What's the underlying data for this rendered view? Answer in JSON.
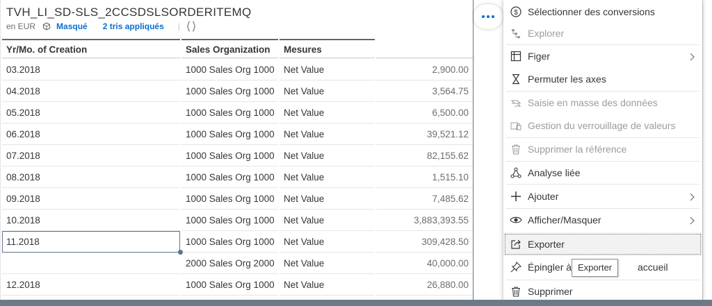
{
  "widget": {
    "title": "TVH_LI_SD-SLS_2CCSDSLSORDERITEMQ",
    "currency": "en EUR",
    "masked": "Masqué",
    "sorts": "2 tris appliqués",
    "pipe": "|",
    "columns": [
      "Yr/Mo. of Creation",
      "Sales Organization",
      "Mesures",
      ""
    ],
    "rows": [
      {
        "date": "03.2018",
        "org": "1000 Sales Org 1000",
        "measure": "Net Value",
        "value": "2,900.00"
      },
      {
        "date": "04.2018",
        "org": "1000 Sales Org 1000",
        "measure": "Net Value",
        "value": "3,564.75"
      },
      {
        "date": "05.2018",
        "org": "1000 Sales Org 1000",
        "measure": "Net Value",
        "value": "6,500.00"
      },
      {
        "date": "06.2018",
        "org": "1000 Sales Org 1000",
        "measure": "Net Value",
        "value": "39,521.12"
      },
      {
        "date": "07.2018",
        "org": "1000 Sales Org 1000",
        "measure": "Net Value",
        "value": "82,155.62"
      },
      {
        "date": "08.2018",
        "org": "1000 Sales Org 1000",
        "measure": "Net Value",
        "value": "1,515.10"
      },
      {
        "date": "09.2018",
        "org": "1000 Sales Org 1000",
        "measure": "Net Value",
        "value": "7,485.62"
      },
      {
        "date": "10.2018",
        "org": "1000 Sales Org 1000",
        "measure": "Net Value",
        "value": "3,883,393.55"
      },
      {
        "date": "11.2018",
        "org": "1000 Sales Org 1000",
        "measure": "Net Value",
        "value": "309,428.50"
      },
      {
        "date": "",
        "org": "2000 Sales Org 2000",
        "measure": "Net Value",
        "value": "40,000.00"
      },
      {
        "date": "12.2018",
        "org": "1000 Sales Org 1000",
        "measure": "Net Value",
        "value": "26,880.00"
      }
    ]
  },
  "menu": {
    "items": [
      {
        "label": "Sélectionner des conversions",
        "icon": "dollar-circle-icon",
        "disabled": false
      },
      {
        "label": "Explorer",
        "icon": "hierarchy-icon",
        "disabled": true
      },
      {
        "label": "Figer",
        "icon": "freeze-table-icon",
        "disabled": false,
        "submenu": true
      },
      {
        "label": "Permuter les axes",
        "icon": "swap-axes-icon",
        "disabled": false
      },
      {
        "label": "Saisie en masse des données",
        "icon": "mass-input-icon",
        "disabled": true
      },
      {
        "label": "Gestion du verrouillage de valeurs",
        "icon": "lock-values-icon",
        "disabled": true
      },
      {
        "label": "Supprimer la référence",
        "icon": "trash-icon",
        "disabled": true
      },
      {
        "label": "Analyse liée",
        "icon": "linked-analysis-icon",
        "disabled": false
      },
      {
        "label": "Ajouter",
        "icon": "plus-icon",
        "disabled": false,
        "submenu": true
      },
      {
        "label": "Afficher/Masquer",
        "icon": "eye-icon",
        "disabled": false,
        "submenu": true
      },
      {
        "label": "Exporter",
        "icon": "export-icon",
        "disabled": false,
        "hover": true
      },
      {
        "label": "Épingler à",
        "label_tail": "accueil",
        "icon": "pin-icon",
        "disabled": false
      },
      {
        "label": "Supprimer",
        "icon": "trash-icon",
        "disabled": false
      }
    ],
    "tooltip": "Exporter"
  },
  "colors": {
    "accent": "#0a6ed1",
    "disabled_text": "#9a9c9e",
    "border_selected": "#5b738b"
  }
}
